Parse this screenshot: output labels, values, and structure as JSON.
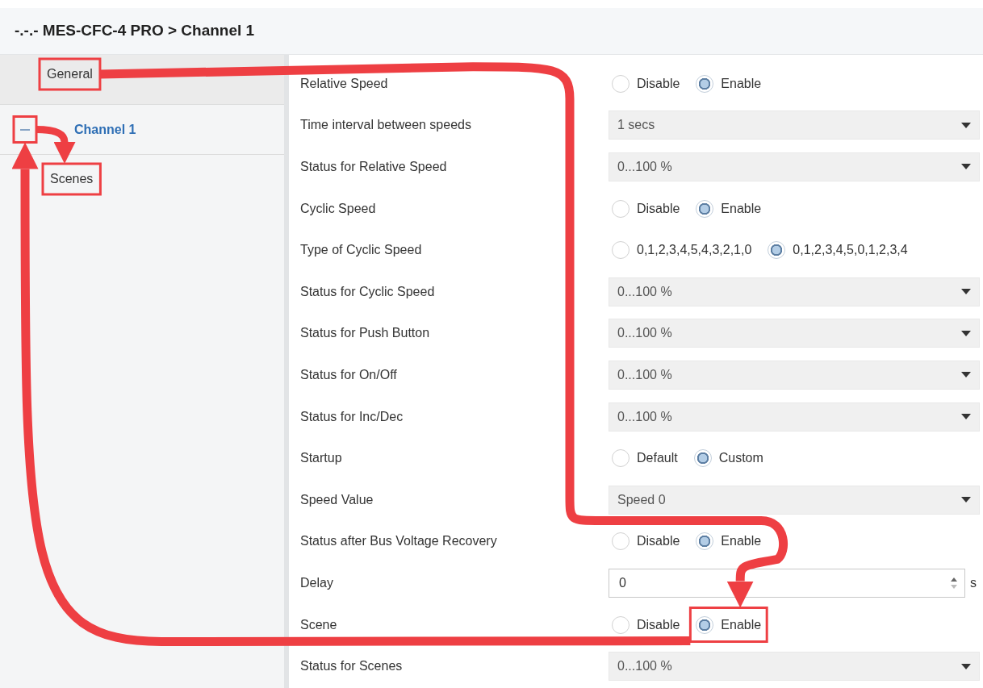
{
  "header": {
    "title": "-.-.- MES-CFC-4 PRO > Channel 1"
  },
  "sidebar": {
    "items": [
      {
        "label": "General",
        "selected": false,
        "highlighted": true
      },
      {
        "label": "Channel 1",
        "selected": true,
        "expanded": true,
        "highlighted": true,
        "children": [
          {
            "label": "Scenes",
            "selected": false,
            "highlighted": true
          }
        ]
      }
    ]
  },
  "parameters": [
    {
      "kind": "radio",
      "label": "Relative Speed",
      "options": [
        {
          "label": "Disable",
          "selected": false
        },
        {
          "label": "Enable",
          "selected": true
        }
      ]
    },
    {
      "kind": "dropdown",
      "label": "Time interval between speeds",
      "value": "1 secs"
    },
    {
      "kind": "dropdown",
      "label": "Status for Relative Speed",
      "value": "0...100 %"
    },
    {
      "kind": "radio",
      "label": "Cyclic Speed",
      "options": [
        {
          "label": "Disable",
          "selected": false
        },
        {
          "label": "Enable",
          "selected": true
        }
      ]
    },
    {
      "kind": "radio",
      "label": "Type of Cyclic Speed",
      "options": [
        {
          "label": "0,1,2,3,4,5,4,3,2,1,0",
          "selected": false
        },
        {
          "label": "0,1,2,3,4,5,0,1,2,3,4",
          "selected": true
        }
      ]
    },
    {
      "kind": "dropdown",
      "label": "Status for Cyclic Speed",
      "value": "0...100 %"
    },
    {
      "kind": "dropdown",
      "label": "Status for Push Button",
      "value": "0...100 %"
    },
    {
      "kind": "dropdown",
      "label": "Status for On/Off",
      "value": "0...100 %"
    },
    {
      "kind": "dropdown",
      "label": "Status for Inc/Dec",
      "value": "0...100 %"
    },
    {
      "kind": "radio",
      "label": "Startup",
      "options": [
        {
          "label": "Default",
          "selected": false
        },
        {
          "label": "Custom",
          "selected": true
        }
      ]
    },
    {
      "kind": "dropdown",
      "label": "Speed Value",
      "value": "Speed 0"
    },
    {
      "kind": "radio",
      "label": "Status after Bus Voltage Recovery",
      "options": [
        {
          "label": "Disable",
          "selected": false
        },
        {
          "label": "Enable",
          "selected": true
        }
      ]
    },
    {
      "kind": "number",
      "label": "Delay",
      "value": "0",
      "unit": "s"
    },
    {
      "kind": "radio",
      "label": "Scene",
      "options": [
        {
          "label": "Disable",
          "selected": false
        },
        {
          "label": "Enable",
          "selected": true,
          "highlighted": true
        }
      ]
    },
    {
      "kind": "dropdown",
      "label": "Status for Scenes",
      "value": "0...100 %"
    }
  ]
}
